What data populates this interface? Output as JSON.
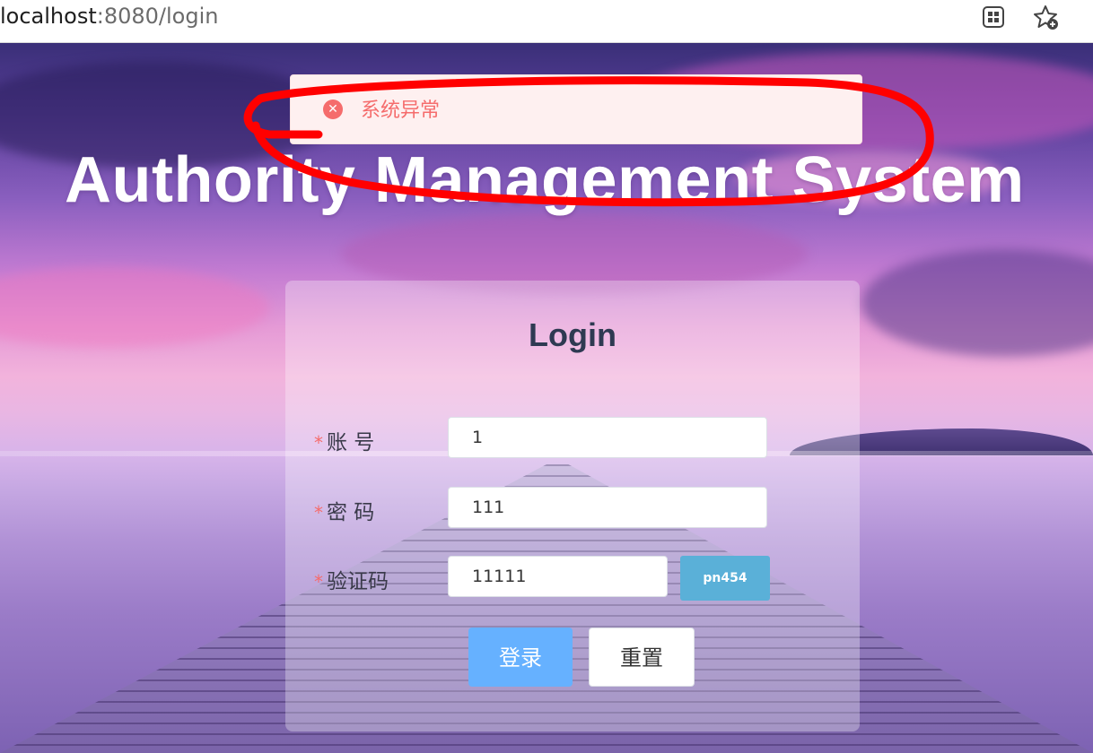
{
  "browser": {
    "url_host": "localhost",
    "url_rest": ":8080/login",
    "icons": [
      "apps-icon",
      "add-favorite-icon"
    ]
  },
  "page": {
    "title": "Authority Management System"
  },
  "alert": {
    "type": "error",
    "icon": "error-circle-icon",
    "message": "系统异常",
    "color": "#f56c6c"
  },
  "login": {
    "title": "Login",
    "fields": [
      {
        "label": "账 号",
        "required": true,
        "value": "1"
      },
      {
        "label": "密 码",
        "required": true,
        "value": "111"
      },
      {
        "label": "验证码",
        "required": true,
        "value": "11111"
      }
    ],
    "captcha_text": "pn454",
    "buttons": {
      "login": "登录",
      "reset": "重置"
    },
    "required_mark": "*"
  },
  "colors": {
    "primary_button": "#66b1ff",
    "captcha_bg": "#5ab0d8",
    "annotation": "#ff0000"
  }
}
